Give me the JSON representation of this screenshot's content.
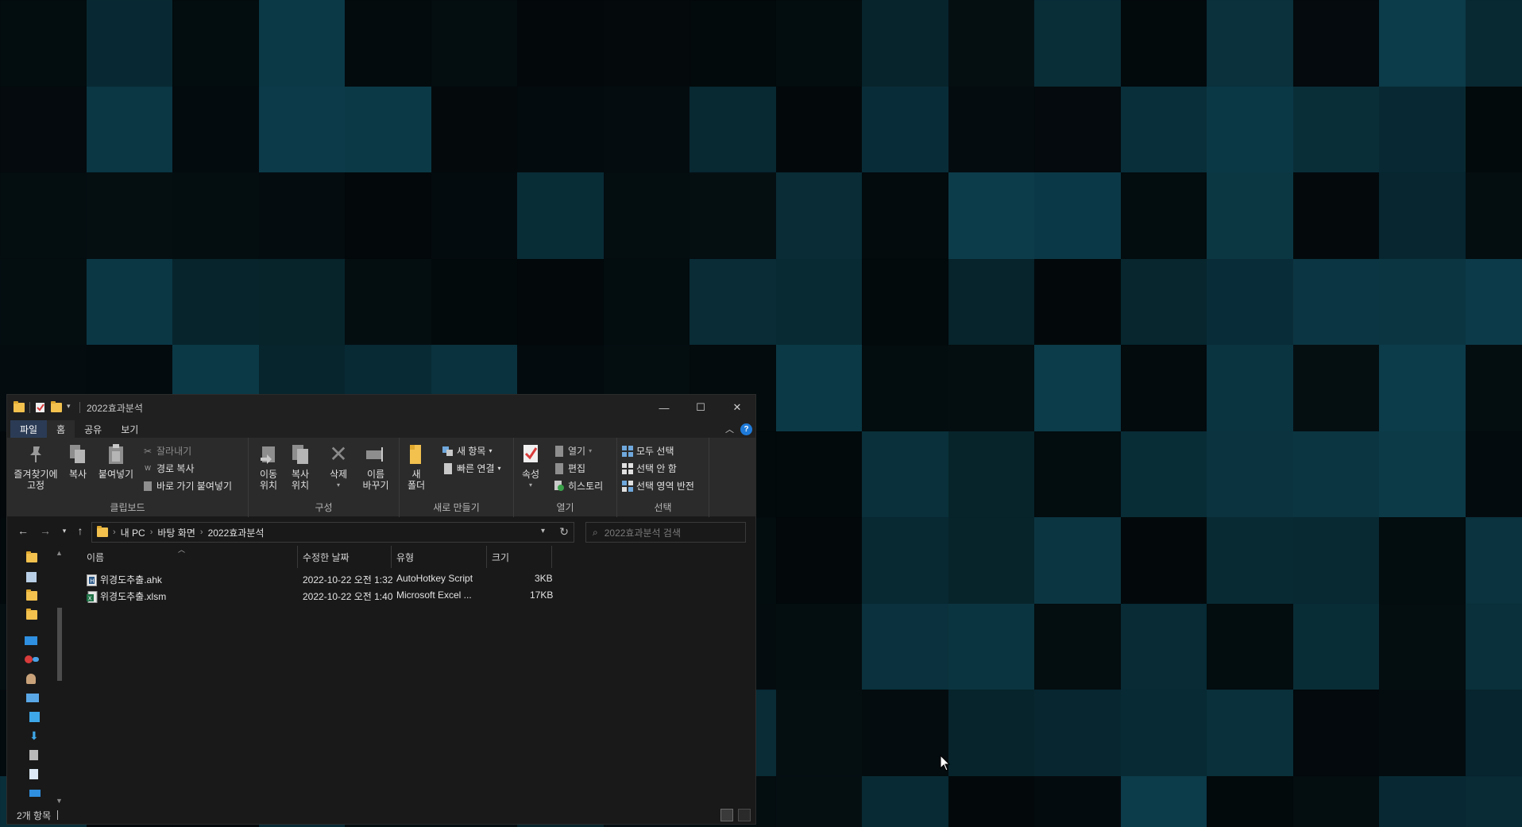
{
  "window": {
    "title": "2022효과분석",
    "controls": {
      "minimize": "—",
      "maximize": "☐",
      "close": "✕"
    }
  },
  "ribbon_tabs": [
    "파일",
    "홈",
    "공유",
    "보기"
  ],
  "ribbon": {
    "clipboard": {
      "label": "클립보드",
      "pin": [
        "즐겨찾기에",
        "고정"
      ],
      "copy": "복사",
      "paste": "붙여넣기",
      "cut": "잘라내기",
      "copy_path": "경로 복사",
      "paste_shortcut": "바로 가기 붙여넣기"
    },
    "organize": {
      "label": "구성",
      "move_to": [
        "이동",
        "위치"
      ],
      "copy_to": [
        "복사",
        "위치"
      ],
      "delete": "삭제",
      "rename": [
        "이름",
        "바꾸기"
      ]
    },
    "new": {
      "label": "새로 만들기",
      "new_folder": [
        "새",
        "폴더"
      ],
      "new_item": "새 항목",
      "easy_access": "빠른 연결"
    },
    "open": {
      "label": "열기",
      "properties": "속성",
      "open": "열기",
      "edit": "편집",
      "history": "히스토리"
    },
    "select": {
      "label": "선택",
      "select_all": "모두 선택",
      "select_none": "선택 안 함",
      "invert": "선택 영역 반전"
    }
  },
  "address": {
    "crumbs": [
      "내 PC",
      "바탕 화면",
      "2022효과분석"
    ],
    "search_placeholder": "2022효과분석 검색"
  },
  "columns": [
    "이름",
    "수정한 날짜",
    "유형",
    "크기"
  ],
  "files": [
    {
      "name": "위경도추출.ahk",
      "date": "2022-10-22 오전 1:32",
      "type": "AutoHotkey Script",
      "size": "3KB",
      "icon": "ahk-file-icon"
    },
    {
      "name": "위경도추출.xlsm",
      "date": "2022-10-22 오전 1:40",
      "type": "Microsoft Excel ...",
      "size": "17KB",
      "icon": "excel-file-icon"
    }
  ],
  "status": {
    "count": "2개 항목"
  },
  "colors": {
    "desktop_bg": "#020506",
    "tile_teal": "#0c3c4a",
    "window_bg": "#191919",
    "ribbon_bg": "#2b2b2b",
    "accent_blue": "#1e7ad9"
  }
}
